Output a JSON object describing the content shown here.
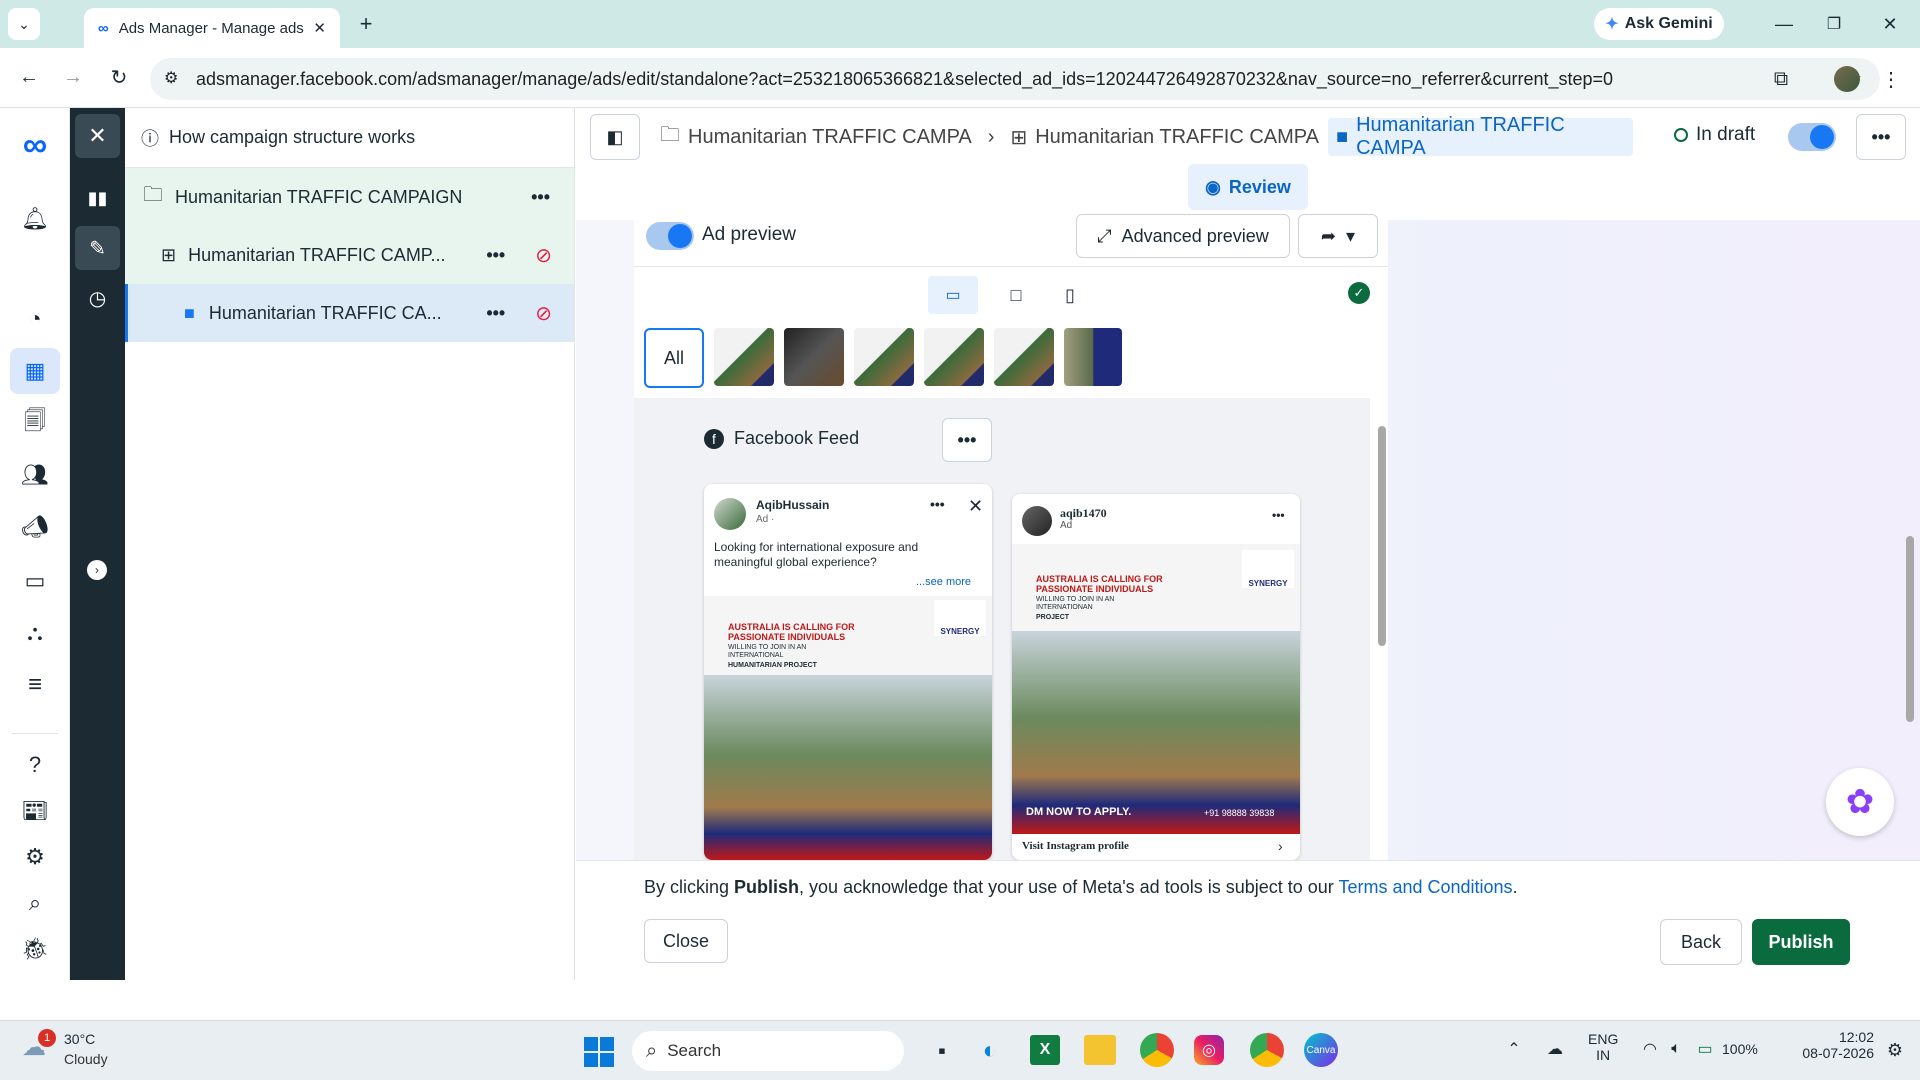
{
  "browser": {
    "tab_title": "Ads Manager - Manage ads - A",
    "url": "adsmanager.facebook.com/adsmanager/manage/ads/edit/standalone?act=253218065366821&selected_ad_ids=120244726492870232&nav_source=no_referrer&current_step=0",
    "gemini_label": "Ask Gemini"
  },
  "sidebar_tree": {
    "help_label": "How campaign structure works",
    "campaign": "Humanitarian TRAFFIC CAMPAIGN",
    "adset": "Humanitarian TRAFFIC CAMP...",
    "ad": "Humanitarian TRAFFIC CA..."
  },
  "breadcrumb": {
    "campaign": "Humanitarian TRAFFIC CAMPA",
    "adset": "Humanitarian TRAFFIC CAMPA",
    "ad": "Humanitarian TRAFFIC CAMPA",
    "status": "In draft"
  },
  "review_label": "Review",
  "preview": {
    "ad_preview_label": "Ad preview",
    "advanced_preview_label": "Advanced preview",
    "all_label": "All",
    "placement_label": "Facebook Feed"
  },
  "post1": {
    "author": "AqibHussain",
    "sub": "Ad · ",
    "text": "Looking for international exposure and meaningful global experience?",
    "see_more": "...see more",
    "headline": "AUSTRALIA IS CALLING FOR PASSIONATE INDIVIDUALS",
    "line2": "WILLING TO JOIN IN AN INTERNATIONAL",
    "line3": "HUMANITARIAN PROJECT",
    "brand": "SYNERGY"
  },
  "post2": {
    "author": "aqib1470",
    "sub": "Ad",
    "headline": "AUSTRALIA IS CALLING FOR PASSIONATE INDIVIDUALS",
    "line2": "WILLING TO JOIN IN AN INTERNATIONAN",
    "line3": "PROJECT",
    "cta": "DM NOW TO APPLY.",
    "phone": "+91 98888 39838",
    "visit": "Visit Instagram profile",
    "brand": "SYNERGY"
  },
  "footer": {
    "pre": "By clicking ",
    "bold": "Publish",
    "post": ", you acknowledge that your use of Meta's ad tools is subject to our ",
    "link": "Terms and Conditions",
    "end": ".",
    "close": "Close",
    "back": "Back",
    "publish": "Publish"
  },
  "taskbar": {
    "temp": "30°C",
    "weather": "Cloudy",
    "badge": "1",
    "search": "Search",
    "lang1": "ENG",
    "lang2": "IN",
    "battery": "100%",
    "time": "12:02",
    "date": "08-07-2026"
  },
  "colors": {
    "accent": "#1877f2",
    "publish": "#0a6b3f",
    "nav_dark": "#1c2b33"
  }
}
